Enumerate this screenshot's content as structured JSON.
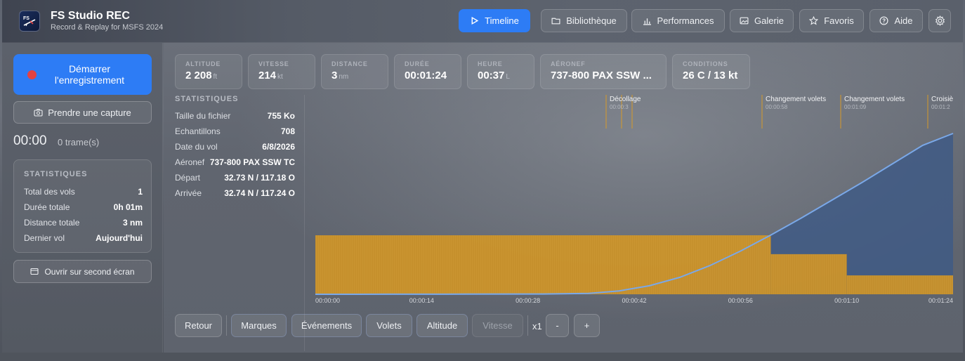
{
  "app": {
    "title": "FS Studio REC",
    "subtitle": "Record & Replay for MSFS 2024",
    "logo_text": "FS"
  },
  "nav": [
    {
      "label": "Timeline",
      "icon": "play-icon",
      "active": true
    },
    {
      "label": "Bibliothèque",
      "icon": "folder-icon"
    },
    {
      "label": "Performances",
      "icon": "bar-chart-icon"
    },
    {
      "label": "Galerie",
      "icon": "image-icon"
    },
    {
      "label": "Favoris",
      "icon": "star-icon"
    },
    {
      "label": "Aide",
      "icon": "help-icon"
    }
  ],
  "sidebar": {
    "record_label": "Démarrer l'enregistrement",
    "capture_label": "Prendre une capture",
    "timer": "00:00",
    "frames": "0 trame(s)",
    "stats_title": "STATISTIQUES",
    "stats": [
      {
        "k": "Total des vols",
        "v": "1"
      },
      {
        "k": "Durée totale",
        "v": "0h 01m"
      },
      {
        "k": "Distance totale",
        "v": "3 nm"
      },
      {
        "k": "Dernier vol",
        "v": "Aujourd'hui"
      }
    ],
    "open_second_label": "Ouvrir sur second écran"
  },
  "metrics": [
    {
      "label": "ALTITUDE",
      "value": "2 208",
      "unit": "ft"
    },
    {
      "label": "VITESSE",
      "value": "214",
      "unit": "kt"
    },
    {
      "label": "DISTANCE",
      "value": "3",
      "unit": "nm"
    },
    {
      "label": "DURÉE",
      "value": "00:01:24",
      "unit": ""
    },
    {
      "label": "HEURE",
      "value": "00:37",
      "unit": "L"
    },
    {
      "label": "AÉRONEF",
      "value": "737-800 PAX SSW ...",
      "unit": ""
    },
    {
      "label": "CONDITIONS",
      "value": "26 C / 13 kt",
      "unit": ""
    }
  ],
  "info": {
    "title": "STATISTIQUES",
    "rows": [
      {
        "k": "Taille du fichier",
        "v": "755 Ko"
      },
      {
        "k": "Echantillons",
        "v": "708"
      },
      {
        "k": "Date du vol",
        "v": "6/8/2026"
      },
      {
        "k": "Aéronef",
        "v": "737-800 PAX SSW TC"
      },
      {
        "k": "Départ",
        "v": "32.73 N / 117.18 O"
      },
      {
        "k": "Arrivée",
        "v": "32.74 N / 117.24 O"
      }
    ]
  },
  "chart_data": {
    "type": "area",
    "x_ticks": [
      "00:00:00",
      "00:00:14",
      "00:00:28",
      "00:00:42",
      "00:00:56",
      "00:01:10",
      "00:01:24"
    ],
    "x_range_s": [
      0,
      84
    ],
    "altitude": {
      "color": "#7aa8e8",
      "points_s": [
        [
          0,
          0
        ],
        [
          10,
          1
        ],
        [
          20,
          2
        ],
        [
          30,
          3
        ],
        [
          36,
          10
        ],
        [
          40,
          40
        ],
        [
          44,
          100
        ],
        [
          48,
          200
        ],
        [
          52,
          340
        ],
        [
          56,
          510
        ],
        [
          60,
          700
        ],
        [
          64,
          900
        ],
        [
          68,
          1110
        ],
        [
          72,
          1320
        ],
        [
          76,
          1540
        ],
        [
          80,
          1760
        ],
        [
          84,
          1900
        ]
      ],
      "max_ft": 1900
    },
    "flaps": {
      "color": "#d69a2a",
      "steps_s": [
        [
          0,
          1.0
        ],
        [
          60,
          1.0
        ],
        [
          60,
          0.68
        ],
        [
          70,
          0.68
        ],
        [
          70,
          0.32
        ],
        [
          84,
          0.32
        ]
      ]
    },
    "events": [
      {
        "label": "Décollage",
        "time": "00:00:3"
      },
      {
        "label": "Changement volets",
        "time": "00:00:58"
      },
      {
        "label": "Changement volets",
        "time": "00:01:09"
      },
      {
        "label": "Croisiè",
        "time": "00:01:2"
      }
    ]
  },
  "controls": {
    "back": "Retour",
    "marks": "Marques",
    "events": "Événements",
    "flaps": "Volets",
    "altitude": "Altitude",
    "speed": "Vitesse",
    "zoom": "x1",
    "minus": "-",
    "plus": "+"
  }
}
